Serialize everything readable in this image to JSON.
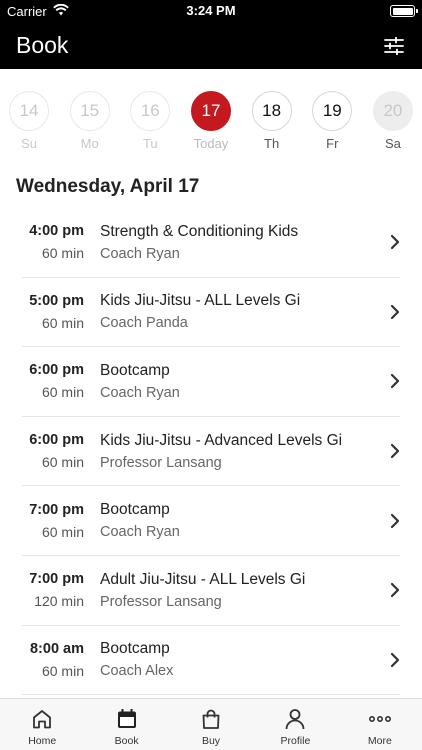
{
  "status": {
    "carrier": "Carrier",
    "time": "3:24 PM"
  },
  "header": {
    "title": "Book"
  },
  "days": [
    {
      "num": "14",
      "label": "Su",
      "state": "past"
    },
    {
      "num": "15",
      "label": "Mo",
      "state": "past"
    },
    {
      "num": "16",
      "label": "Tu",
      "state": "past"
    },
    {
      "num": "17",
      "label": "Today",
      "state": "today"
    },
    {
      "num": "18",
      "label": "Th",
      "state": "active"
    },
    {
      "num": "19",
      "label": "Fr",
      "state": "active"
    },
    {
      "num": "20",
      "label": "Sa",
      "state": "sat"
    }
  ],
  "schedule": {
    "date": "Wednesday, April 17",
    "classes": [
      {
        "time": "4:00 pm",
        "duration": "60 min",
        "name": "Strength & Conditioning Kids",
        "coach": "Coach Ryan"
      },
      {
        "time": "5:00 pm",
        "duration": "60 min",
        "name": "Kids Jiu-Jitsu - ALL Levels Gi",
        "coach": "Coach Panda"
      },
      {
        "time": "6:00 pm",
        "duration": "60 min",
        "name": "Bootcamp",
        "coach": "Coach Ryan"
      },
      {
        "time": "6:00 pm",
        "duration": "60 min",
        "name": "Kids Jiu-Jitsu - Advanced Levels Gi",
        "coach": "Professor Lansang"
      },
      {
        "time": "7:00 pm",
        "duration": "60 min",
        "name": "Bootcamp",
        "coach": "Coach Ryan"
      },
      {
        "time": "7:00 pm",
        "duration": "120 min",
        "name": "Adult Jiu-Jitsu - ALL Levels Gi",
        "coach": "Professor Lansang"
      },
      {
        "time": "8:00 am",
        "duration": "60 min",
        "name": "Bootcamp",
        "coach": "Coach Alex"
      }
    ]
  },
  "tabs": [
    {
      "label": "Home",
      "icon": "home-icon"
    },
    {
      "label": "Book",
      "icon": "calendar-icon"
    },
    {
      "label": "Buy",
      "icon": "bag-icon"
    },
    {
      "label": "Profile",
      "icon": "person-icon"
    },
    {
      "label": "More",
      "icon": "more-icon"
    }
  ],
  "colors": {
    "accent": "#c4191f",
    "header_bg": "#000000"
  }
}
